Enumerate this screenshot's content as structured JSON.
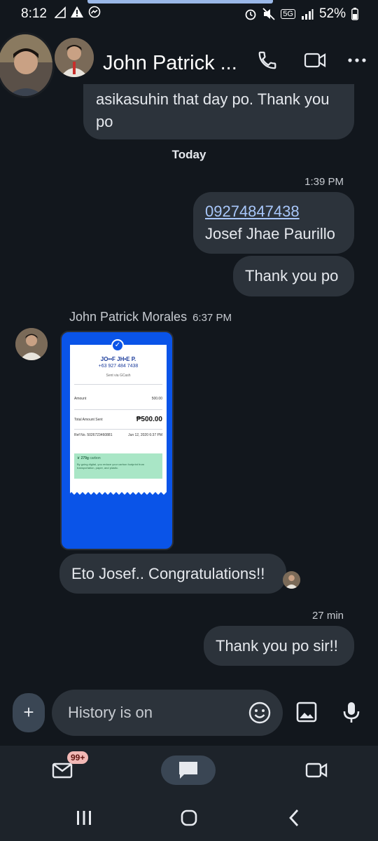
{
  "status_bar": {
    "time": "8:12",
    "network_label": "5G",
    "battery": "52%"
  },
  "header": {
    "contact_name": "John Patrick ...",
    "icons": [
      "call-icon",
      "video-call-icon",
      "more-icon"
    ]
  },
  "messages": {
    "prev_bubble_text_1": "asikasuhin that day po. Thank you",
    "prev_bubble_text_2": "po",
    "day_separator": "Today",
    "time_1": "1:39 PM",
    "bubble_1_number": "09274847438",
    "bubble_1_name": "Josef Jhae Paurillo",
    "bubble_2": "Thank you po",
    "sender_name": "John Patrick Morales",
    "sender_time": "6:37 PM",
    "incoming_bubble": "Eto Josef.. Congratulations!!",
    "time_2": "27 min",
    "bubble_3": "Thank you po sir!!"
  },
  "receipt": {
    "name": "JO••F JH•E P.",
    "phone": "+63 927 484 7438",
    "sent_via": "Sent via GCash",
    "amount_label": "Amount",
    "amount_value": "500.00",
    "total_label": "Total Amount Sent",
    "total_value": "₱500.00",
    "ref_label": "Ref No. 5026723460881",
    "ref_date": "Jun 12, 2020 6:37 PM",
    "green_title": "279g",
    "green_unit": "carbon",
    "green_text": "By going digital, you reduce your carbon footprint from transportation, paper, and plastic."
  },
  "compose": {
    "placeholder": "History is on"
  },
  "bottom_nav": {
    "badge": "99+"
  },
  "colors": {
    "background": "#12171d",
    "bubble": "#2c333b",
    "link": "#a8c7fa",
    "gcash_blue": "#0a54e8"
  }
}
